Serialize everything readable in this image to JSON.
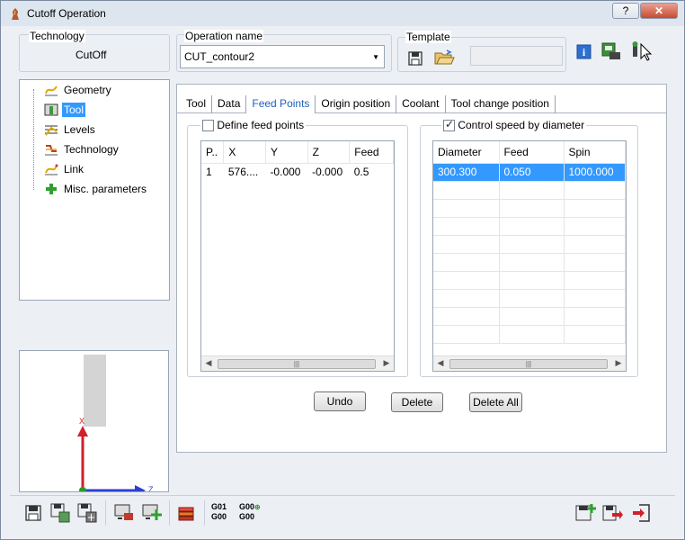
{
  "window": {
    "title": "Cutoff Operation",
    "help_glyph": "?",
    "close_glyph": "✕"
  },
  "technology": {
    "label": "Technology",
    "value": "CutOff"
  },
  "operation_name": {
    "label": "Operation name",
    "value": "CUT_contour2"
  },
  "template": {
    "label": "Template",
    "value": ""
  },
  "tree": {
    "items": [
      {
        "label": "Geometry",
        "icon": "geometry-icon",
        "selected": false
      },
      {
        "label": "Tool",
        "icon": "tool-icon",
        "selected": true
      },
      {
        "label": "Levels",
        "icon": "levels-icon",
        "selected": false
      },
      {
        "label": "Technology",
        "icon": "technology-icon",
        "selected": false
      },
      {
        "label": "Link",
        "icon": "link-icon",
        "selected": false
      },
      {
        "label": "Misc. parameters",
        "icon": "plus-icon",
        "selected": false
      }
    ]
  },
  "preview": {
    "axis_x": "X",
    "axis_z": "Z"
  },
  "tabs": [
    {
      "label": "Tool",
      "active": false
    },
    {
      "label": "Data",
      "active": false
    },
    {
      "label": "Feed Points",
      "active": true
    },
    {
      "label": "Origin position",
      "active": false
    },
    {
      "label": "Coolant",
      "active": false
    },
    {
      "label": "Tool change position",
      "active": false
    }
  ],
  "feed_points": {
    "checkbox_label": "Define feed points",
    "checked": false,
    "columns": [
      "P..",
      "X",
      "Y",
      "Z",
      "Feed"
    ],
    "rows": [
      [
        "1",
        "576....",
        "-0.000",
        "-0.000",
        "0.5"
      ]
    ]
  },
  "control_speed": {
    "checkbox_label": "Control speed by diameter",
    "checked": true,
    "columns": [
      "Diameter",
      "Feed",
      "Spin"
    ],
    "rows": [
      [
        "300.300",
        "0.050",
        "1000.000"
      ]
    ]
  },
  "buttons": {
    "undo": "Undo",
    "delete": "Delete",
    "delete_all": "Delete All"
  },
  "bottom_toolbar": {
    "g01_label": "G01",
    "g00_label": "G00"
  },
  "colors": {
    "selection": "#3399ff",
    "active_tab": "#1e5fbf",
    "close_button": "#c84a31"
  }
}
